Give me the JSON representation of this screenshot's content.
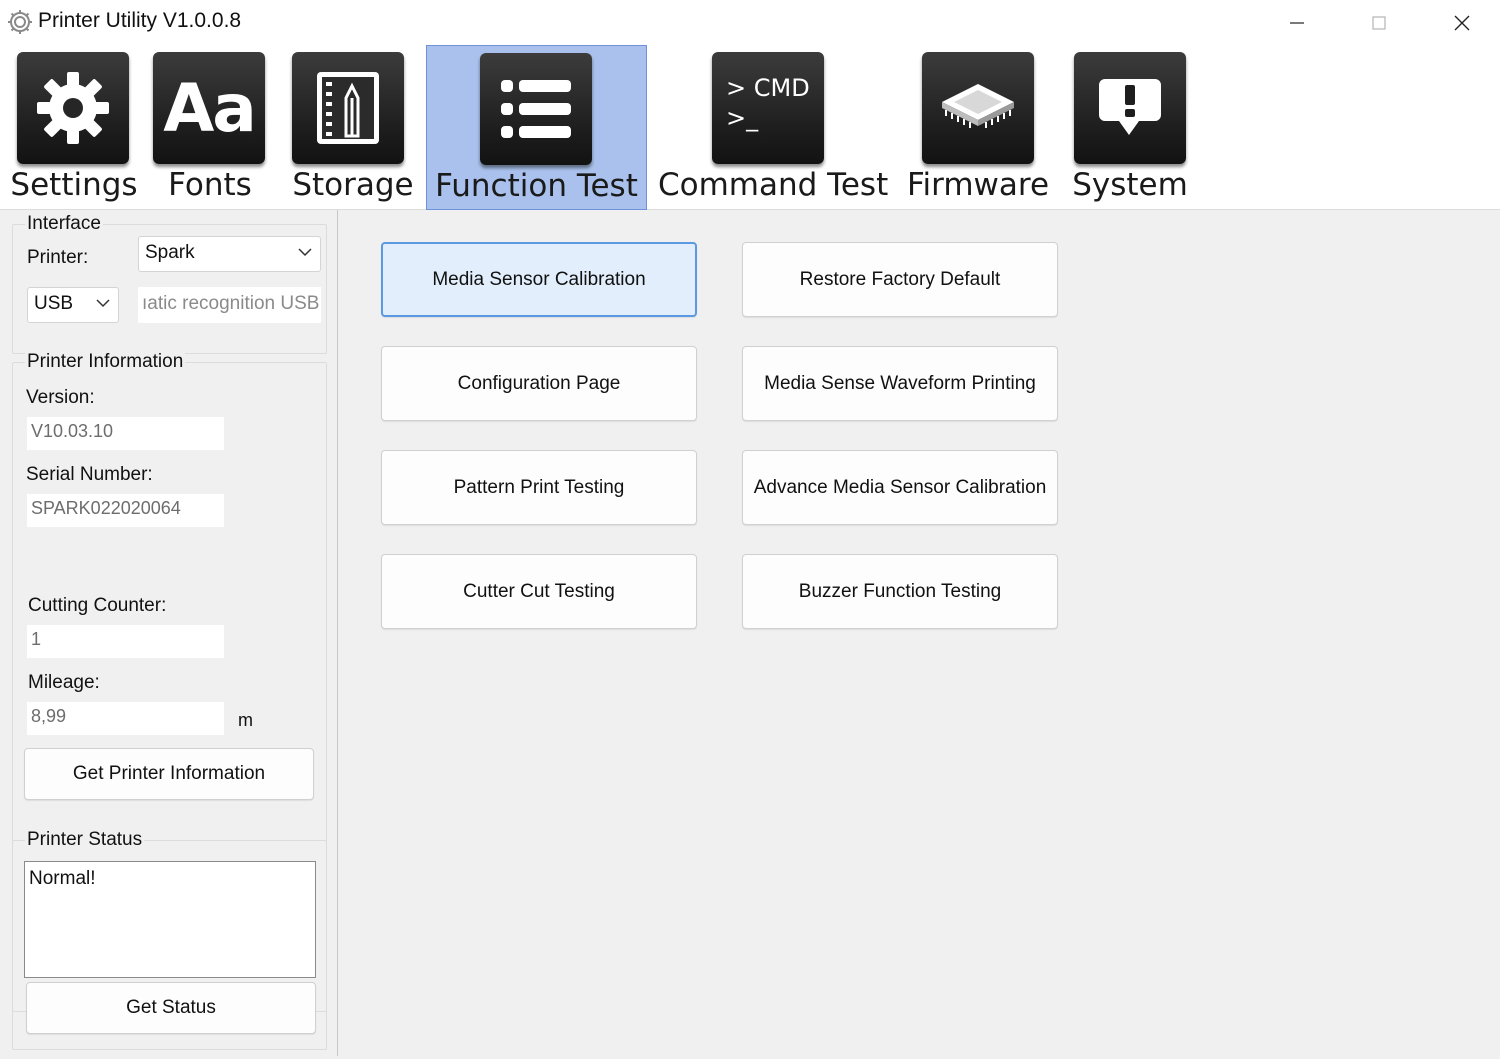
{
  "window": {
    "title": "Printer Utility  V1.0.0.8"
  },
  "toolbar": {
    "items": [
      {
        "label": "Settings",
        "icon": "gear-icon"
      },
      {
        "label": "Fonts",
        "icon": "font-aa-icon"
      },
      {
        "label": "Storage",
        "icon": "storage-icon"
      },
      {
        "label": "Function Test",
        "icon": "list-icon",
        "active": true
      },
      {
        "label": "Command Test",
        "icon": "cmd-icon",
        "icon_text_1": "> CMD",
        "icon_text_2": ">_"
      },
      {
        "label": "Firmware",
        "icon": "chip-icon"
      },
      {
        "label": "System",
        "icon": "alert-icon"
      }
    ],
    "active_color": "#a9c1ec"
  },
  "interface": {
    "title": "Interface",
    "printer_label": "Printer:",
    "printer_value": "Spark",
    "port_value": "USB",
    "port_detail": "ıatic recognition USB"
  },
  "printer_info": {
    "title": "Printer Information",
    "version_label": "Version:",
    "version_value": "V10.03.10",
    "serial_label": "Serial Number:",
    "serial_value": "SPARK022020064",
    "cutting_label": "Cutting Counter:",
    "cutting_value": "1",
    "mileage_label": "Mileage:",
    "mileage_value": "8,99",
    "mileage_unit": "m",
    "get_info_button": "Get Printer Information"
  },
  "printer_status": {
    "title": "Printer Status",
    "status_text": "Normal!",
    "get_status_button": "Get Status"
  },
  "functions": {
    "buttons": [
      "Media Sensor Calibration",
      "Restore Factory Default",
      "Configuration Page",
      "Media Sense Waveform Printing",
      "Pattern Print Testing",
      "Advance Media Sensor Calibration",
      "Cutter Cut Testing",
      "Buzzer Function Testing"
    ]
  }
}
